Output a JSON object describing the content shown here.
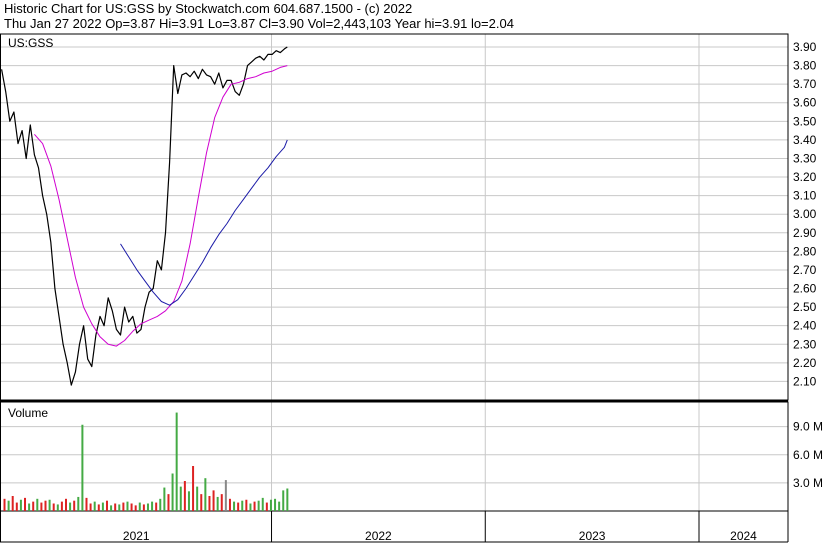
{
  "header": {
    "line1": "Historic Chart for US:GSS by Stockwatch.com 604.687.1500 - (c) 2022",
    "line2": "Thu Jan 27 2022  Op=3.87  Hi=3.91  Lo=3.87  Cl=3.90  Vol=2,443,103  Year hi=3.91  lo=2.04"
  },
  "chart_data": [
    {
      "type": "line",
      "label": "US:GSS",
      "ylim": [
        2.0,
        3.97
      ],
      "yticks": [
        2.1,
        2.2,
        2.3,
        2.4,
        2.5,
        2.6,
        2.7,
        2.8,
        2.9,
        3.0,
        3.1,
        3.2,
        3.3,
        3.4,
        3.5,
        3.6,
        3.7,
        3.8,
        3.9
      ],
      "ytick_labels": [
        "2.10",
        "2.20",
        "2.30",
        "2.40",
        "2.50",
        "2.60",
        "2.70",
        "2.80",
        "2.90",
        "3.00",
        "3.10",
        "3.20",
        "3.30",
        "3.40",
        "3.50",
        "3.60",
        "3.70",
        "3.80",
        "3.90"
      ],
      "x_start": "2020-09-25",
      "xlim": [
        "2020-09-25",
        "2024-05-31"
      ],
      "grid": true,
      "colors": {
        "price": "#000000",
        "ma_short": "#d000d0",
        "ma_long": "#1c1ca8",
        "grid": "#c8c8c8"
      },
      "series": [
        {
          "role": "price",
          "x": [
            "2020-09-26",
            "2020-10-03",
            "2020-10-10",
            "2020-10-17",
            "2020-10-24",
            "2020-10-31",
            "2020-11-07",
            "2020-11-14",
            "2020-11-21",
            "2020-11-28",
            "2020-12-05",
            "2020-12-12",
            "2020-12-19",
            "2020-12-26",
            "2021-01-02",
            "2021-01-09",
            "2021-01-16",
            "2021-01-23",
            "2021-01-30",
            "2021-02-06",
            "2021-02-13",
            "2021-02-20",
            "2021-02-27",
            "2021-03-06",
            "2021-03-13",
            "2021-03-20",
            "2021-03-27",
            "2021-04-03",
            "2021-04-10",
            "2021-04-17",
            "2021-04-24",
            "2021-05-01",
            "2021-05-08",
            "2021-05-15",
            "2021-05-22",
            "2021-05-29",
            "2021-06-05",
            "2021-06-12",
            "2021-06-19",
            "2021-06-26",
            "2021-07-03",
            "2021-07-10",
            "2021-07-17",
            "2021-07-24",
            "2021-07-31",
            "2021-08-07",
            "2021-08-14",
            "2021-08-21",
            "2021-08-28",
            "2021-09-04",
            "2021-09-11",
            "2021-09-18",
            "2021-09-25",
            "2021-10-02",
            "2021-10-09",
            "2021-10-16",
            "2021-10-23",
            "2021-10-30",
            "2021-11-06",
            "2021-11-13",
            "2021-11-20",
            "2021-11-27",
            "2021-12-04",
            "2021-12-11",
            "2021-12-18",
            "2021-12-25",
            "2022-01-01",
            "2022-01-08",
            "2022-01-15",
            "2022-01-22",
            "2022-01-27"
          ],
          "values": [
            3.78,
            3.66,
            3.5,
            3.55,
            3.38,
            3.45,
            3.3,
            3.48,
            3.32,
            3.25,
            3.1,
            3.0,
            2.85,
            2.6,
            2.45,
            2.3,
            2.2,
            2.08,
            2.15,
            2.3,
            2.4,
            2.22,
            2.18,
            2.35,
            2.45,
            2.4,
            2.55,
            2.48,
            2.38,
            2.35,
            2.5,
            2.42,
            2.45,
            2.36,
            2.38,
            2.5,
            2.58,
            2.6,
            2.75,
            2.7,
            2.9,
            3.28,
            3.8,
            3.65,
            3.75,
            3.76,
            3.74,
            3.77,
            3.73,
            3.78,
            3.75,
            3.74,
            3.7,
            3.76,
            3.68,
            3.72,
            3.72,
            3.66,
            3.64,
            3.7,
            3.8,
            3.82,
            3.84,
            3.85,
            3.83,
            3.86,
            3.86,
            3.88,
            3.87,
            3.89,
            3.9
          ]
        },
        {
          "role": "ma_short",
          "x": [
            "2020-11-21",
            "2020-12-05",
            "2020-12-19",
            "2021-01-02",
            "2021-01-16",
            "2021-01-30",
            "2021-02-13",
            "2021-02-27",
            "2021-03-13",
            "2021-03-27",
            "2021-04-10",
            "2021-04-24",
            "2021-05-08",
            "2021-05-22",
            "2021-06-05",
            "2021-06-19",
            "2021-07-03",
            "2021-07-17",
            "2021-07-31",
            "2021-08-14",
            "2021-08-28",
            "2021-09-11",
            "2021-09-25",
            "2021-10-09",
            "2021-10-23",
            "2021-11-06",
            "2021-11-20",
            "2021-12-04",
            "2021-12-18",
            "2022-01-01",
            "2022-01-15",
            "2022-01-27"
          ],
          "values": [
            3.43,
            3.38,
            3.26,
            3.08,
            2.87,
            2.66,
            2.5,
            2.41,
            2.34,
            2.3,
            2.29,
            2.32,
            2.37,
            2.41,
            2.43,
            2.45,
            2.48,
            2.53,
            2.64,
            2.84,
            3.09,
            3.33,
            3.52,
            3.63,
            3.7,
            3.71,
            3.73,
            3.74,
            3.76,
            3.77,
            3.79,
            3.8
          ]
        },
        {
          "role": "ma_long",
          "x": [
            "2021-04-17",
            "2021-05-01",
            "2021-05-15",
            "2021-05-29",
            "2021-06-12",
            "2021-06-26",
            "2021-07-10",
            "2021-07-24",
            "2021-08-07",
            "2021-08-21",
            "2021-09-04",
            "2021-09-18",
            "2021-10-02",
            "2021-10-16",
            "2021-10-30",
            "2021-11-13",
            "2021-11-27",
            "2021-12-11",
            "2021-12-25",
            "2022-01-08",
            "2022-01-22",
            "2022-01-27"
          ],
          "values": [
            2.84,
            2.77,
            2.7,
            2.64,
            2.58,
            2.53,
            2.51,
            2.54,
            2.6,
            2.67,
            2.74,
            2.82,
            2.89,
            2.95,
            3.02,
            3.08,
            3.14,
            3.2,
            3.25,
            3.31,
            3.36,
            3.4
          ]
        }
      ]
    },
    {
      "type": "bar",
      "label": "Volume",
      "ylim": [
        0,
        11.2
      ],
      "yticks": [
        3.0,
        6.0,
        9.0
      ],
      "ytick_labels": [
        "3.0 M",
        "6.0 M",
        "9.0 M"
      ],
      "colors": {
        "up": "#44aa44",
        "down": "#dd2222",
        "neutral": "#888888"
      },
      "x_start": "2020-09-25",
      "x": [
        "2020-10-01",
        "2020-10-08",
        "2020-10-15",
        "2020-10-22",
        "2020-10-29",
        "2020-11-05",
        "2020-11-12",
        "2020-11-19",
        "2020-11-26",
        "2020-12-03",
        "2020-12-10",
        "2020-12-17",
        "2020-12-24",
        "2020-12-31",
        "2021-01-07",
        "2021-01-14",
        "2021-01-21",
        "2021-01-28",
        "2021-02-04",
        "2021-02-11",
        "2021-02-18",
        "2021-02-25",
        "2021-03-04",
        "2021-03-11",
        "2021-03-18",
        "2021-03-25",
        "2021-04-01",
        "2021-04-08",
        "2021-04-15",
        "2021-04-22",
        "2021-04-29",
        "2021-05-06",
        "2021-05-13",
        "2021-05-20",
        "2021-05-27",
        "2021-06-03",
        "2021-06-10",
        "2021-06-17",
        "2021-06-24",
        "2021-07-01",
        "2021-07-08",
        "2021-07-15",
        "2021-07-22",
        "2021-07-29",
        "2021-08-05",
        "2021-08-12",
        "2021-08-19",
        "2021-08-26",
        "2021-09-02",
        "2021-09-09",
        "2021-09-16",
        "2021-09-23",
        "2021-09-30",
        "2021-10-07",
        "2021-10-14",
        "2021-10-21",
        "2021-10-28",
        "2021-11-04",
        "2021-11-11",
        "2021-11-18",
        "2021-11-25",
        "2021-12-02",
        "2021-12-09",
        "2021-12-16",
        "2021-12-23",
        "2021-12-30",
        "2022-01-06",
        "2022-01-13",
        "2022-01-20",
        "2022-01-27"
      ],
      "values": [
        1.3,
        1.1,
        1.6,
        0.9,
        1.2,
        1.4,
        0.8,
        1.0,
        1.3,
        0.9,
        1.1,
        1.2,
        0.8,
        0.7,
        1.0,
        1.3,
        0.9,
        1.1,
        1.5,
        9.2,
        1.4,
        0.8,
        1.0,
        0.7,
        0.9,
        1.1,
        0.6,
        0.8,
        0.7,
        0.9,
        1.0,
        0.8,
        0.6,
        0.9,
        0.7,
        0.8,
        1.0,
        0.9,
        1.3,
        2.5,
        1.8,
        4.0,
        10.5,
        2.6,
        3.2,
        2.1,
        4.8,
        2.6,
        1.8,
        3.5,
        1.6,
        2.2,
        1.5,
        1.8,
        3.3,
        1.3,
        1.0,
        0.9,
        1.1,
        1.2,
        0.8,
        1.0,
        1.1,
        1.4,
        0.9,
        1.2,
        1.3,
        1.0,
        2.2,
        2.4
      ],
      "directions": [
        "down",
        "up",
        "down",
        "down",
        "up",
        "down",
        "up",
        "down",
        "up",
        "down",
        "down",
        "up",
        "down",
        "up",
        "down",
        "down",
        "up",
        "down",
        "up",
        "up",
        "down",
        "down",
        "up",
        "down",
        "up",
        "down",
        "up",
        "down",
        "up",
        "down",
        "up",
        "down",
        "down",
        "up",
        "down",
        "up",
        "up",
        "down",
        "up",
        "up",
        "down",
        "up",
        "up",
        "up",
        "down",
        "up",
        "down",
        "up",
        "down",
        "up",
        "down",
        "down",
        "up",
        "down",
        "neutral",
        "down",
        "up",
        "down",
        "up",
        "down",
        "up",
        "down",
        "up",
        "up",
        "down",
        "up",
        "up",
        "up",
        "up",
        "up"
      ]
    }
  ],
  "x_axis": {
    "labels": [
      "2021",
      "2022",
      "2023",
      "2024"
    ]
  }
}
